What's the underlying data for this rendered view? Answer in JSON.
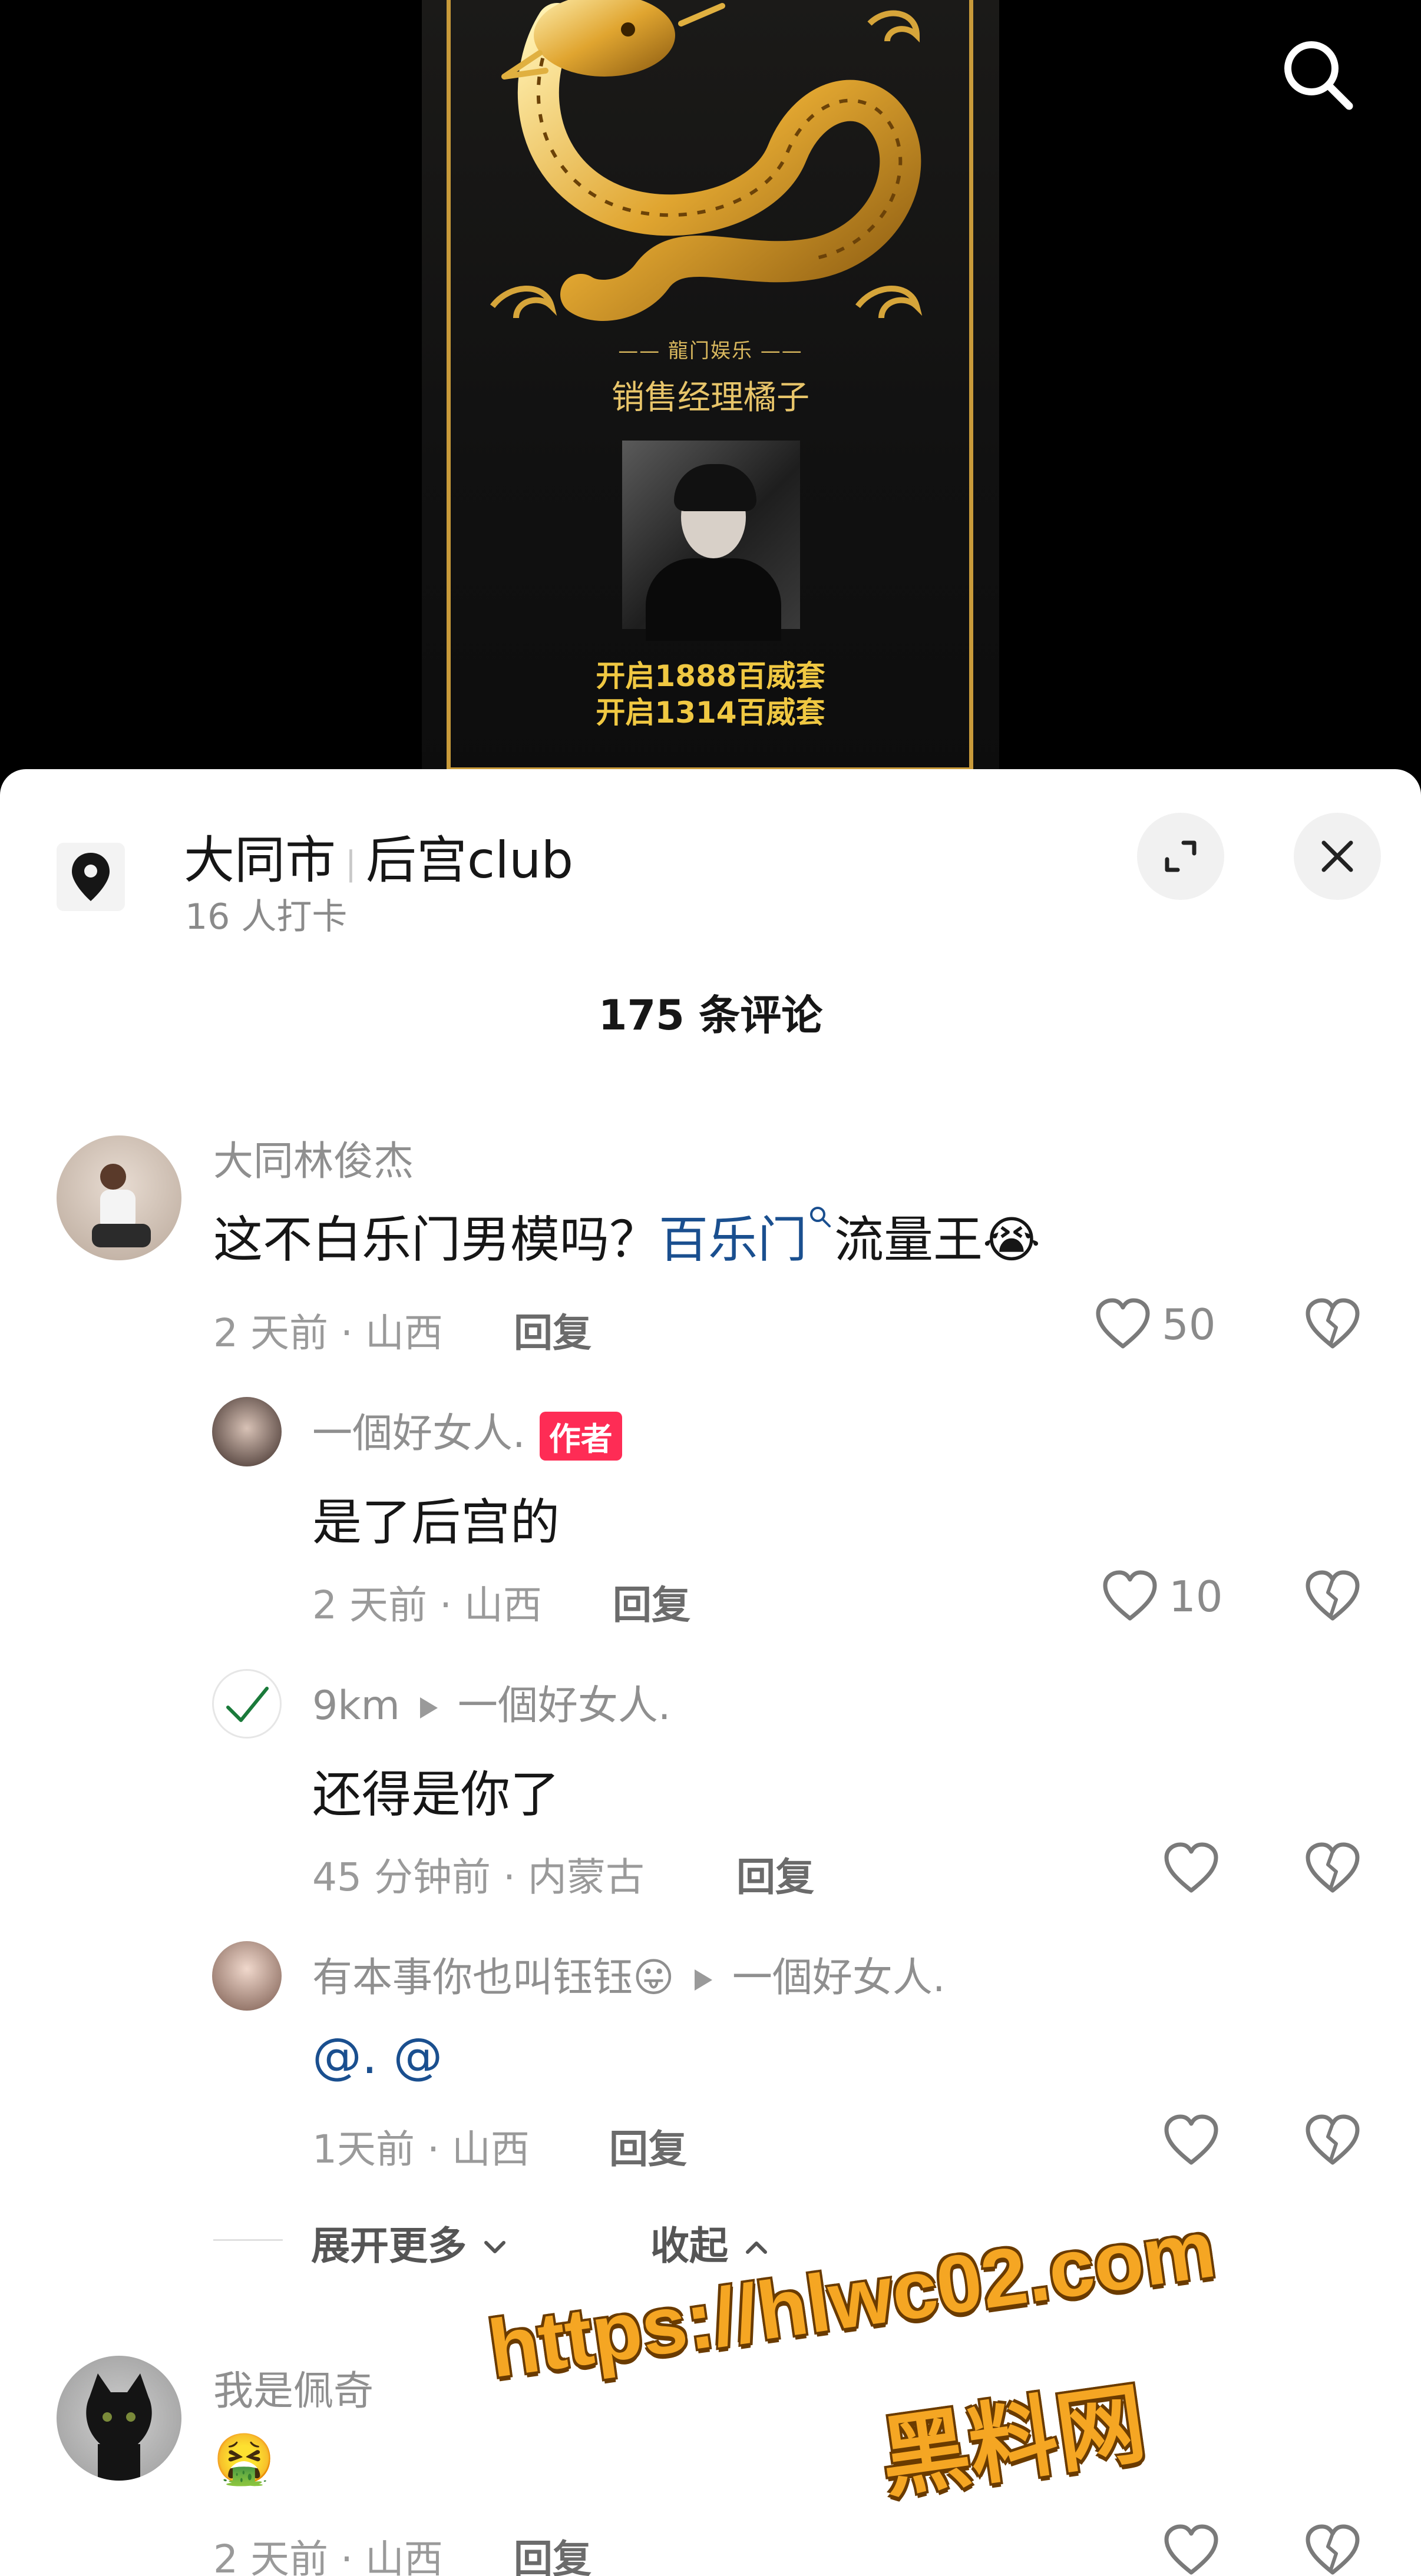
{
  "poster": {
    "brand": "—— 龍门娱乐 ——",
    "manager": "销售经理橘子",
    "line1": "开启1888百威套",
    "line2": "开启1314百威套"
  },
  "location": {
    "city": "大同市",
    "venue": "后宫club",
    "checkins": "16 人打卡"
  },
  "comment_count": "175 条评论",
  "comments": [
    {
      "username": "大同林俊杰",
      "text_before": "这不白乐门男模吗？",
      "link": "百乐门",
      "text_after": "流量王",
      "emoji": "😭",
      "time_location": "2 天前 · 山西",
      "reply": "回复",
      "likes": "50"
    },
    {
      "username": "一個好女人.",
      "badge": "作者",
      "text": "是了后宫的",
      "time_location": "2 天前 · 山西",
      "reply": "回复",
      "likes": "10"
    },
    {
      "username": "9km",
      "reply_to": "一個好女人.",
      "text": "还得是你了",
      "time_location": "45 分钟前 · 内蒙古",
      "reply": "回复"
    },
    {
      "username": "有本事你也叫钰钰",
      "emoji": "😛",
      "reply_to": "一個好女人.",
      "text": "@. @",
      "time_location": "1天前 · 山西",
      "reply": "回复"
    },
    {
      "username": "我是佩奇",
      "emoji": "🤮",
      "time_location": "2 天前 · 山西",
      "reply": "回复"
    }
  ],
  "expand_more": "展开更多",
  "collapse": "收起",
  "watermark": {
    "url": "https://hlwc02.com",
    "name": "黑料网"
  },
  "colors": {
    "link": "#1a4f8f",
    "badge": "#fe2c55",
    "gold": "#e8c56a"
  }
}
